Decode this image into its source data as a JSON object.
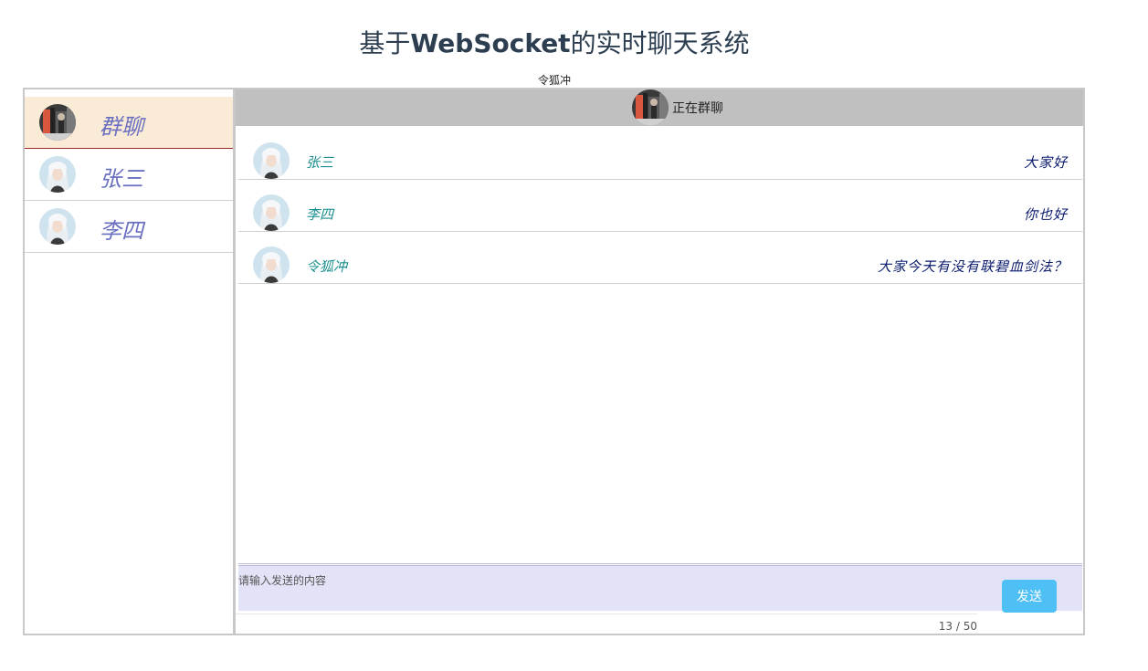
{
  "page": {
    "title_prefix": "基于",
    "title_bold": "WebSocket",
    "title_suffix": "的实时聊天系统",
    "current_user": "令狐冲"
  },
  "sidebar": {
    "items": [
      {
        "label": "群聊",
        "avatar": "group-avatar",
        "active": true
      },
      {
        "label": "张三",
        "avatar": "user-avatar",
        "active": false
      },
      {
        "label": "李四",
        "avatar": "user-avatar",
        "active": false
      }
    ]
  },
  "chat": {
    "header_text": "正在群聊",
    "messages": [
      {
        "sender": "张三",
        "text": "大家好"
      },
      {
        "sender": "李四",
        "text": "你也好"
      },
      {
        "sender": "令狐冲",
        "text": "大家今天有没有联碧血剑法？"
      }
    ],
    "input": {
      "value": "",
      "placeholder": "请输入发送的内容"
    },
    "send_label": "发送",
    "counter": "13 / 50"
  },
  "colors": {
    "active_item_bg": "#faebd7",
    "header_bg": "#c0c0c0",
    "composer_bg": "#e3e3f7",
    "send_button": "#4fc0f6",
    "sidebar_name": "#6a6fc0",
    "sender_name": "#1a8e8e",
    "message_text": "#0a1a6e"
  }
}
